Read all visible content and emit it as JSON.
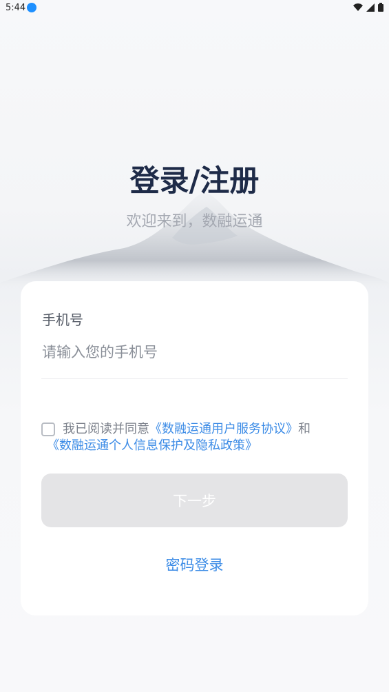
{
  "status_bar": {
    "time": "5:44",
    "icons": [
      "download-icon",
      "wifi-icon",
      "signal-icon",
      "battery-icon"
    ]
  },
  "header": {
    "title": "登录/注册",
    "subtitle": "欢迎来到，数融运通"
  },
  "form": {
    "phone_label": "手机号",
    "phone_placeholder": "请输入您的手机号",
    "phone_value": "",
    "agreement": {
      "checked": false,
      "prefix": "我已阅读并同意",
      "link1": "《数融运通用户服务协议》",
      "conjunction": "和",
      "link2": "《数融运通个人信息保护及隐私政策》"
    },
    "next_button": "下一步",
    "password_login": "密码登录"
  },
  "colors": {
    "title": "#1e2b48",
    "subtitle": "#a4a8b1",
    "link": "#3b8be6",
    "button_disabled": "#e4e4e6"
  }
}
